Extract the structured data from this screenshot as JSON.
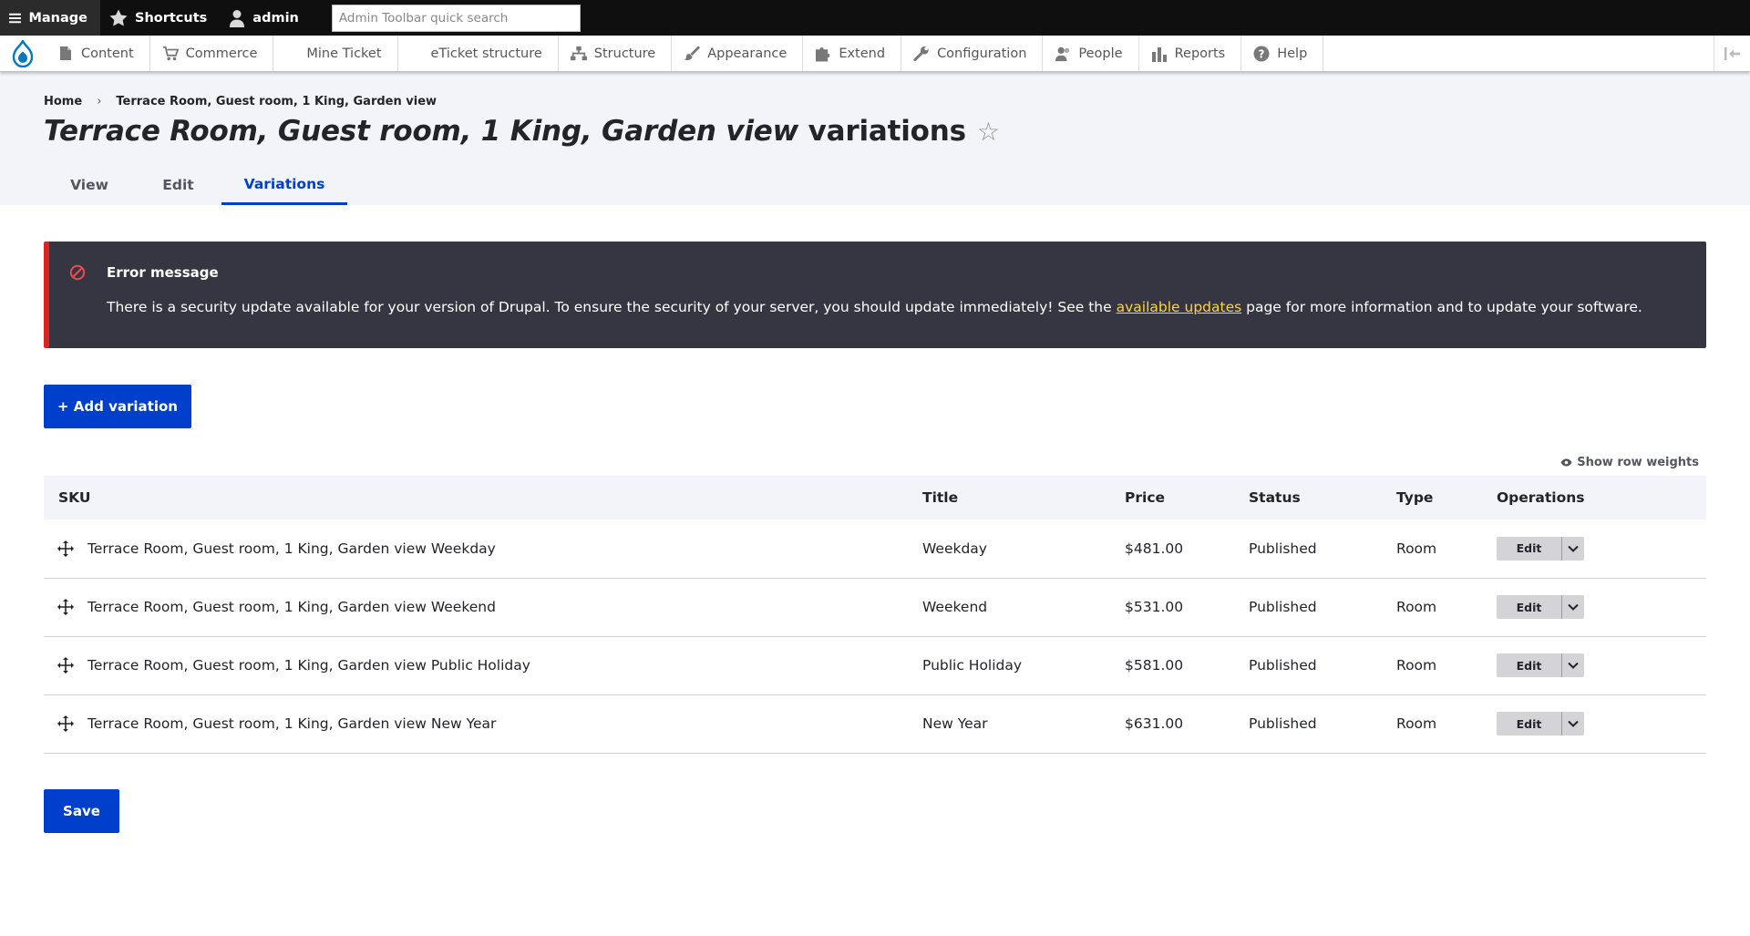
{
  "toolbar": {
    "manage_label": "Manage",
    "shortcuts_label": "Shortcuts",
    "user_label": "admin",
    "search_placeholder": "Admin Toolbar quick search"
  },
  "admin_menu": {
    "items": [
      {
        "label": "Content",
        "icon": "content-icon"
      },
      {
        "label": "Commerce",
        "icon": "cart-icon"
      },
      {
        "label": "Mine Ticket",
        "icon": ""
      },
      {
        "label": "eTicket structure",
        "icon": ""
      },
      {
        "label": "Structure",
        "icon": "structure-icon"
      },
      {
        "label": "Appearance",
        "icon": "paintbrush-icon"
      },
      {
        "label": "Extend",
        "icon": "puzzle-icon"
      },
      {
        "label": "Configuration",
        "icon": "wrench-icon"
      },
      {
        "label": "People",
        "icon": "people-icon"
      },
      {
        "label": "Reports",
        "icon": "bar-chart-icon"
      },
      {
        "label": "Help",
        "icon": "help-icon"
      }
    ]
  },
  "breadcrumb": {
    "home": "Home",
    "separator": "›",
    "current": "Terrace Room, Guest room, 1 King, Garden view"
  },
  "page": {
    "title_italic": "Terrace Room, Guest room, 1 King, Garden view",
    "title_suffix": "variations",
    "star": "☆"
  },
  "tabs": [
    {
      "label": "View",
      "active": false
    },
    {
      "label": "Edit",
      "active": false
    },
    {
      "label": "Variations",
      "active": true
    }
  ],
  "message": {
    "title": "Error message",
    "body_before": "There is a security update available for your version of Drupal. To ensure the security of your server, you should update immediately! See the ",
    "link_text": "available updates",
    "body_after": " page for more information and to update your software."
  },
  "add_button_label": "+ Add variation",
  "row_weights_label": "Show row weights",
  "table": {
    "headers": {
      "sku": "SKU",
      "title": "Title",
      "price": "Price",
      "status": "Status",
      "type": "Type",
      "operations": "Operations"
    },
    "rows": [
      {
        "sku": "Terrace Room, Guest room, 1 King, Garden view Weekday",
        "title": "Weekday",
        "price": "$481.00",
        "status": "Published",
        "type": "Room",
        "op": "Edit"
      },
      {
        "sku": "Terrace Room, Guest room, 1 King, Garden view Weekend",
        "title": "Weekend",
        "price": "$531.00",
        "status": "Published",
        "type": "Room",
        "op": "Edit"
      },
      {
        "sku": "Terrace Room, Guest room, 1 King, Garden view Public Holiday",
        "title": "Public Holiday",
        "price": "$581.00",
        "status": "Published",
        "type": "Room",
        "op": "Edit"
      },
      {
        "sku": "Terrace Room, Guest room, 1 King, Garden view New Year",
        "title": "New Year",
        "price": "$631.00",
        "status": "Published",
        "type": "Room",
        "op": "Edit"
      }
    ]
  },
  "save_label": "Save",
  "colors": {
    "primary": "#003ecc",
    "error": "#dc2323",
    "link": "#ffd23f"
  }
}
